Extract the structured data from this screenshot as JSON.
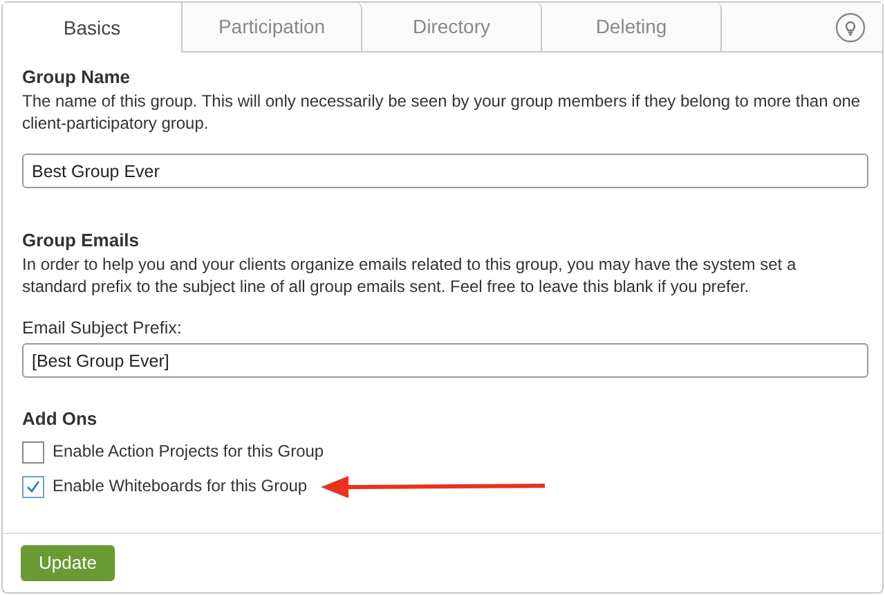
{
  "tabs": [
    {
      "label": "Basics",
      "selected": true
    },
    {
      "label": "Participation",
      "selected": false
    },
    {
      "label": "Directory",
      "selected": false
    },
    {
      "label": "Deleting",
      "selected": false
    }
  ],
  "sections": [
    {
      "kind": "field",
      "heading": "Group Name",
      "description": "The name of this group. This will only necessarily be seen by your group members if they belong to more than one client-participatory group.",
      "value": "Best Group Ever"
    },
    {
      "kind": "field",
      "heading": "Group Emails",
      "description": "In order to help you and your clients organize emails related to this group, you may have the system set a standard prefix to the subject line of all group emails sent. Feel free to leave this blank if you prefer.",
      "label": "Email Subject Prefix:",
      "value": "[Best Group Ever]"
    },
    {
      "kind": "checks",
      "heading": "Add Ons",
      "options": [
        {
          "label": "Enable Action Projects for this Group",
          "checked": false
        },
        {
          "label": "Enable Whiteboards for this Group",
          "checked": true
        }
      ]
    }
  ],
  "button": "Update"
}
